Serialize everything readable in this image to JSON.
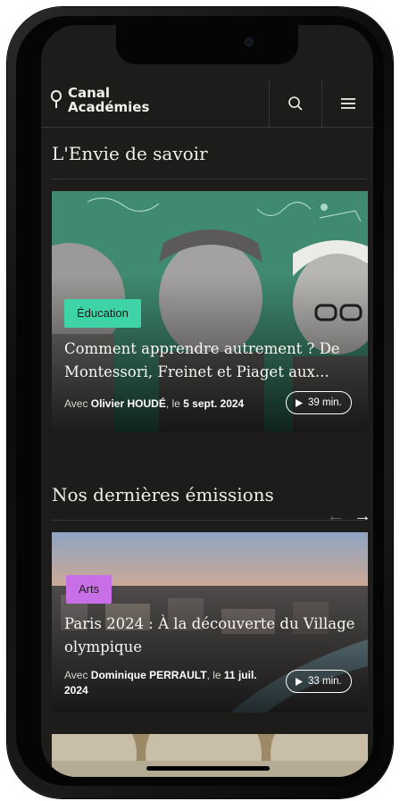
{
  "header": {
    "logo_line1": "Canal",
    "logo_line2": "Académies"
  },
  "featured": {
    "section_title": "L'Envie de savoir",
    "badge": "Éducation",
    "badge_color": "#3fd3a8",
    "background_color": "#3f8a70",
    "title": "Comment apprendre autrement ? De Montessori, Freinet et Piaget aux...",
    "meta_prefix": "Avec ",
    "speaker": "Olivier HOUDÉ",
    "meta_middle": ", le ",
    "date": "5 sept. 2024",
    "duration": "39 min."
  },
  "latest": {
    "section_title": "Nos dernières émissions",
    "prev_arrow": "←",
    "next_arrow": "→",
    "badge": "Arts",
    "badge_color": "#c86ee6",
    "title": "Paris 2024 : À la découverte du Village olympique",
    "meta_prefix": "Avec ",
    "speaker": "Dominique PERRAULT",
    "meta_middle": ", le ",
    "date": "11 juil. 2024",
    "duration": "33 min."
  },
  "icons": {
    "logo": "microphone-logo-icon",
    "search": "search-icon",
    "menu": "hamburger-menu-icon",
    "play": "play-icon"
  }
}
